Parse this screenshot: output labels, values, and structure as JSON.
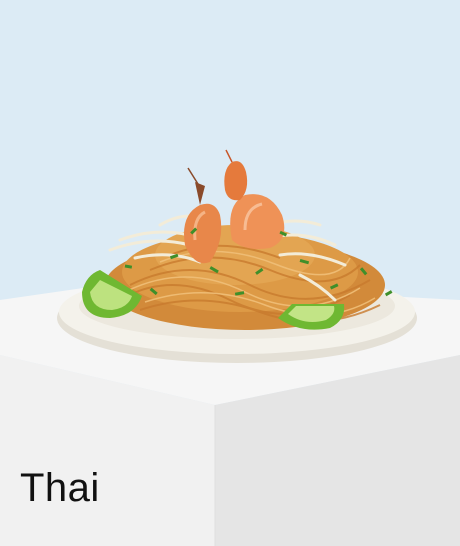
{
  "card": {
    "category_label": "Thai",
    "image_subject": "pad-thai-dish",
    "colors": {
      "background": "#dcebf5",
      "pedestal_top": "#f6f6f6",
      "pedestal_front": "#efefef",
      "pedestal_side": "#e4e4e4",
      "plate": "#f3f1ea",
      "noodles": "#d9913c",
      "shrimp": "#e8874a",
      "lime": "#7cc43b",
      "herbs": "#3f8f2a",
      "label_text": "#111111"
    }
  }
}
